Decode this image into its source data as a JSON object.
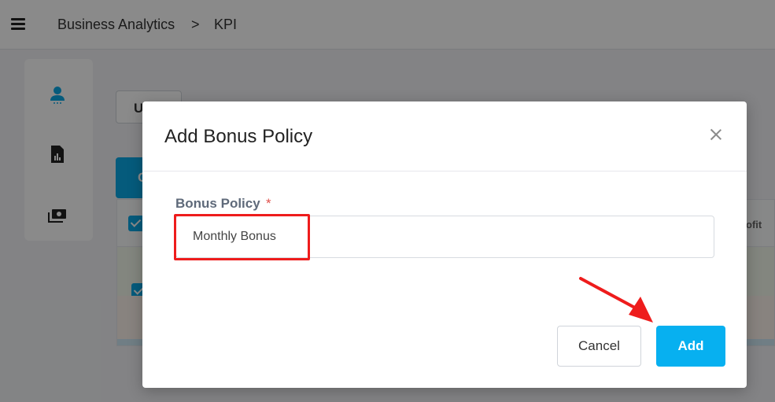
{
  "header": {
    "breadcrumb": [
      "Business Analytics",
      "KPI"
    ],
    "separator": ">"
  },
  "sidebar": {
    "icons": [
      "user-icon",
      "report-icon",
      "money-icon"
    ]
  },
  "background": {
    "button_label": "U",
    "tab_label": "C",
    "column_header_partial": "ofit"
  },
  "modal": {
    "title": "Add Bonus Policy",
    "field_label": "Bonus Policy",
    "required_mark": "*",
    "field_value": "Monthly Bonus",
    "cancel_label": "Cancel",
    "add_label": "Add"
  },
  "colors": {
    "accent": "#07b0f0",
    "highlight": "#ee1c1c",
    "required": "#e0524d"
  }
}
